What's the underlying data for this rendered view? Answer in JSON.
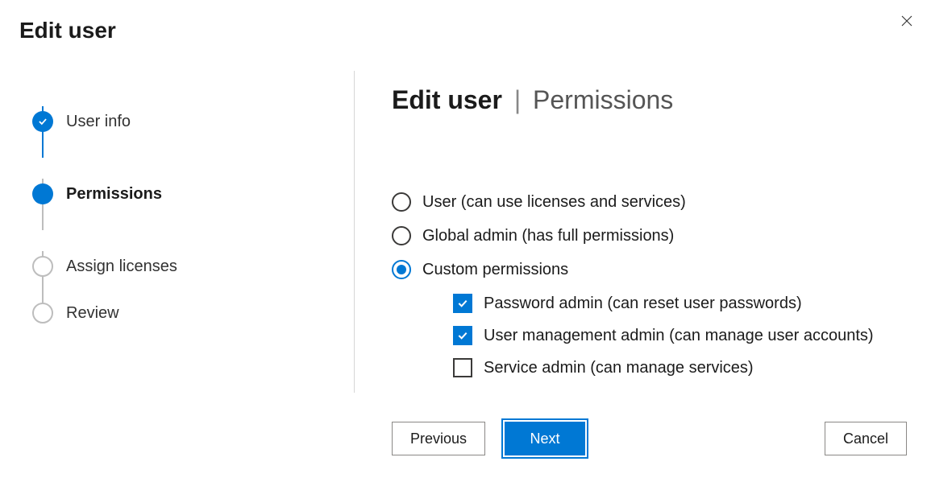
{
  "dialog": {
    "title": "Edit user"
  },
  "stepper": {
    "steps": [
      {
        "label": "User info",
        "state": "done"
      },
      {
        "label": "Permissions",
        "state": "current"
      },
      {
        "label": "Assign licenses",
        "state": "future"
      },
      {
        "label": "Review",
        "state": "future"
      }
    ]
  },
  "heading": {
    "context": "Edit user",
    "separator": "|",
    "page": "Permissions"
  },
  "permissions": {
    "options": [
      {
        "label": "User (can use licenses and services)",
        "selected": false
      },
      {
        "label": "Global admin (has full permissions)",
        "selected": false
      },
      {
        "label": "Custom permissions",
        "selected": true
      }
    ],
    "custom_roles": [
      {
        "label": "Password admin (can reset user passwords)",
        "checked": true
      },
      {
        "label": "User management admin (can manage user accounts)",
        "checked": true
      },
      {
        "label": "Service admin (can manage services)",
        "checked": false
      }
    ]
  },
  "footer": {
    "previous": "Previous",
    "next": "Next",
    "cancel": "Cancel"
  }
}
